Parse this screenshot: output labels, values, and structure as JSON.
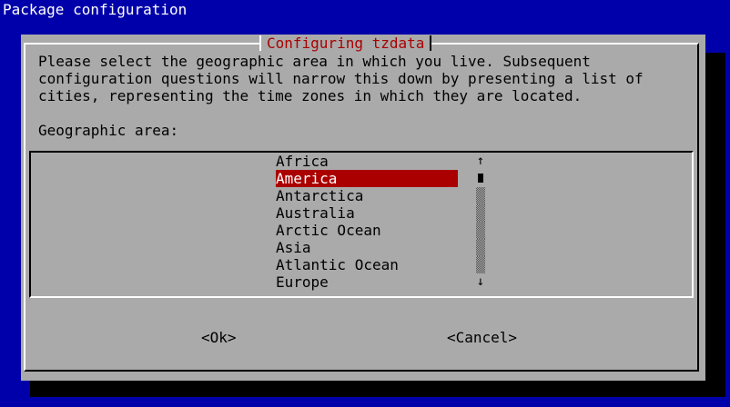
{
  "window": {
    "title": "Package configuration"
  },
  "dialog": {
    "title": "Configuring tzdata",
    "description_lines": [
      "Please select the geographic area in which you live. Subsequent",
      "configuration questions will narrow this down by presenting a list of",
      "cities, representing the time zones in which they are located."
    ],
    "prompt": "Geographic area:",
    "list": {
      "items": [
        "Africa",
        "America",
        "Antarctica",
        "Australia",
        "Arctic Ocean",
        "Asia",
        "Atlantic Ocean",
        "Europe"
      ],
      "selected_index": 1,
      "selected_label": "America"
    },
    "scrollbar": {
      "up_icon": "arrow-up-icon",
      "down_icon": "arrow-down-icon",
      "up_glyph": "↑",
      "down_glyph": "↓"
    },
    "buttons": {
      "ok_label": "<Ok>",
      "cancel_label": "<Cancel>"
    }
  },
  "colors": {
    "background": "#0000aa",
    "dialog": "#aaaaaa",
    "title_text": "#aa0000",
    "selection": "#aa0000",
    "shadow": "#000000"
  }
}
